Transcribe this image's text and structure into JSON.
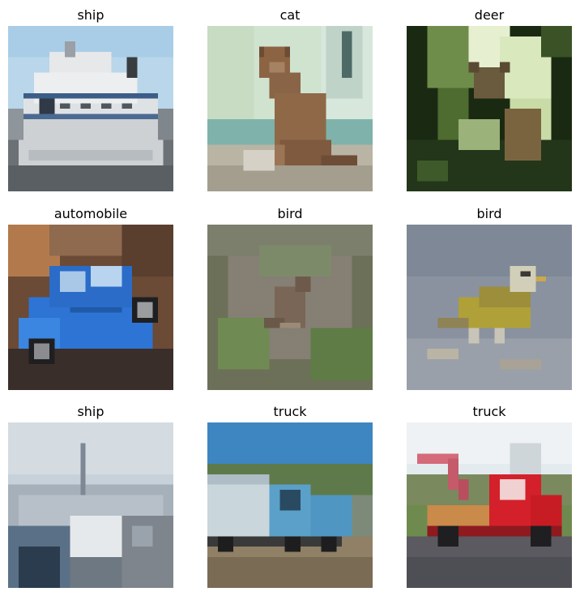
{
  "grid": {
    "images": [
      {
        "label": "ship",
        "subject": "ship-photo"
      },
      {
        "label": "cat",
        "subject": "cat-photo"
      },
      {
        "label": "deer",
        "subject": "deer-photo"
      },
      {
        "label": "automobile",
        "subject": "automobile-photo"
      },
      {
        "label": "bird",
        "subject": "bird-photo"
      },
      {
        "label": "bird",
        "subject": "bird-photo"
      },
      {
        "label": "ship",
        "subject": "ship-photo"
      },
      {
        "label": "truck",
        "subject": "truck-photo"
      },
      {
        "label": "truck",
        "subject": "truck-photo"
      }
    ]
  }
}
